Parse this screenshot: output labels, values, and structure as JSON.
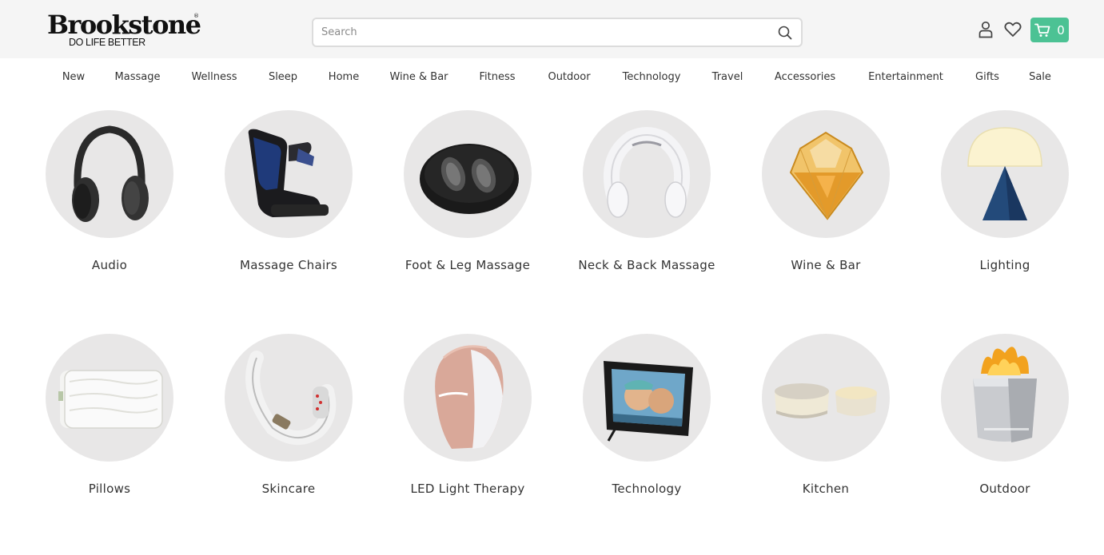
{
  "header": {
    "logo": "Brookstone",
    "logo_tagline": "DO LIFE BETTER",
    "logo_mark": "®",
    "search_placeholder": "Search",
    "cart_count": "0",
    "icons": {
      "search": "search-icon",
      "account": "user-icon",
      "wishlist": "heart-icon",
      "cart": "cart-icon"
    },
    "colors": {
      "header_bg": "#f5f5f5",
      "cart_bg": "#4cc294",
      "circle_bg": "#e8e7e7"
    }
  },
  "nav": {
    "items": [
      {
        "label": "New"
      },
      {
        "label": "Massage"
      },
      {
        "label": "Wellness"
      },
      {
        "label": "Sleep"
      },
      {
        "label": "Home"
      },
      {
        "label": "Wine & Bar"
      },
      {
        "label": "Fitness"
      },
      {
        "label": "Outdoor"
      },
      {
        "label": "Technology"
      },
      {
        "label": "Travel"
      },
      {
        "label": "Accessories"
      },
      {
        "label": "Entertainment"
      },
      {
        "label": "Gifts"
      },
      {
        "label": "Sale"
      }
    ]
  },
  "categories": [
    {
      "label": "Audio",
      "image": "headphones"
    },
    {
      "label": "Massage Chairs",
      "image": "massage-chair"
    },
    {
      "label": "Foot & Leg Massage",
      "image": "foot-massager"
    },
    {
      "label": "Neck & Back Massage",
      "image": "neck-massager"
    },
    {
      "label": "Wine & Bar",
      "image": "whiskey-glass"
    },
    {
      "label": "Lighting",
      "image": "lamp"
    },
    {
      "label": "Pillows",
      "image": "pillow"
    },
    {
      "label": "Skincare",
      "image": "skincare-device"
    },
    {
      "label": "LED Light Therapy",
      "image": "led-mask"
    },
    {
      "label": "Technology",
      "image": "photo-frame"
    },
    {
      "label": "Kitchen",
      "image": "bowls"
    },
    {
      "label": "Outdoor",
      "image": "fire-pit"
    }
  ]
}
